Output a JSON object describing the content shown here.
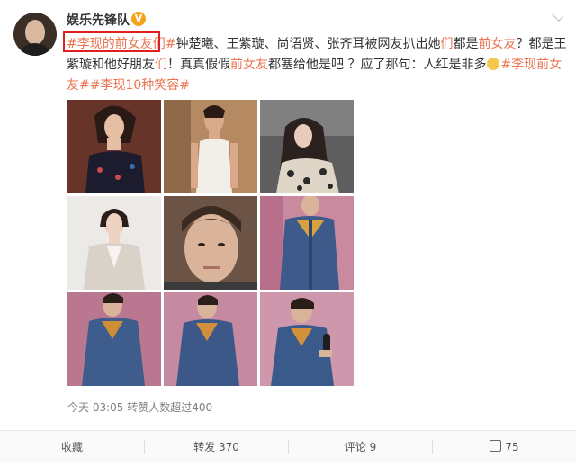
{
  "post": {
    "username": "娱乐先锋队",
    "verified_badge": "V",
    "content": {
      "hashtag1": "#李现的前女友们#",
      "seg1": "钟楚曦、王紫璇、尚语贤、张齐耳被网友扒出她",
      "hl1": "们",
      "seg2": "都是",
      "hl2": "前女友",
      "seg3": "？都是王紫璇和他好朋友",
      "hl3": "们",
      "seg4": "！真真假假",
      "hl4": "前女友",
      "seg5": "都塞给他是吧 ？应了那句：人红是非多",
      "hashtag2": "#李现前女友#",
      "hashtag3": "#李现10种笑容#"
    },
    "photos": [
      {
        "name": "woman-strapless-dress",
        "bg": "#7a3b2e"
      },
      {
        "name": "woman-white-tank",
        "bg": "#c7a27a"
      },
      {
        "name": "woman-leopard-top",
        "bg": "#6b6b6b"
      },
      {
        "name": "woman-white-blazer",
        "bg": "#e9e5e0"
      },
      {
        "name": "man-selfie",
        "bg": "#8a6a55"
      },
      {
        "name": "man-denim-jacket-1",
        "bg": "#c98aa0"
      },
      {
        "name": "man-denim-jacket-2",
        "bg": "#b9788f"
      },
      {
        "name": "man-denim-jacket-3",
        "bg": "#c58aa2"
      },
      {
        "name": "man-denim-jacket-microphone",
        "bg": "#cf97ab"
      }
    ],
    "meta": "今天 03:05 转赞人数超过400"
  },
  "actions": {
    "favorite": "收藏",
    "repost": "转发 370",
    "comment": "评论 9",
    "like": "75"
  },
  "colors": {
    "link": "#eb7350",
    "highlight_box": "#e02020"
  }
}
